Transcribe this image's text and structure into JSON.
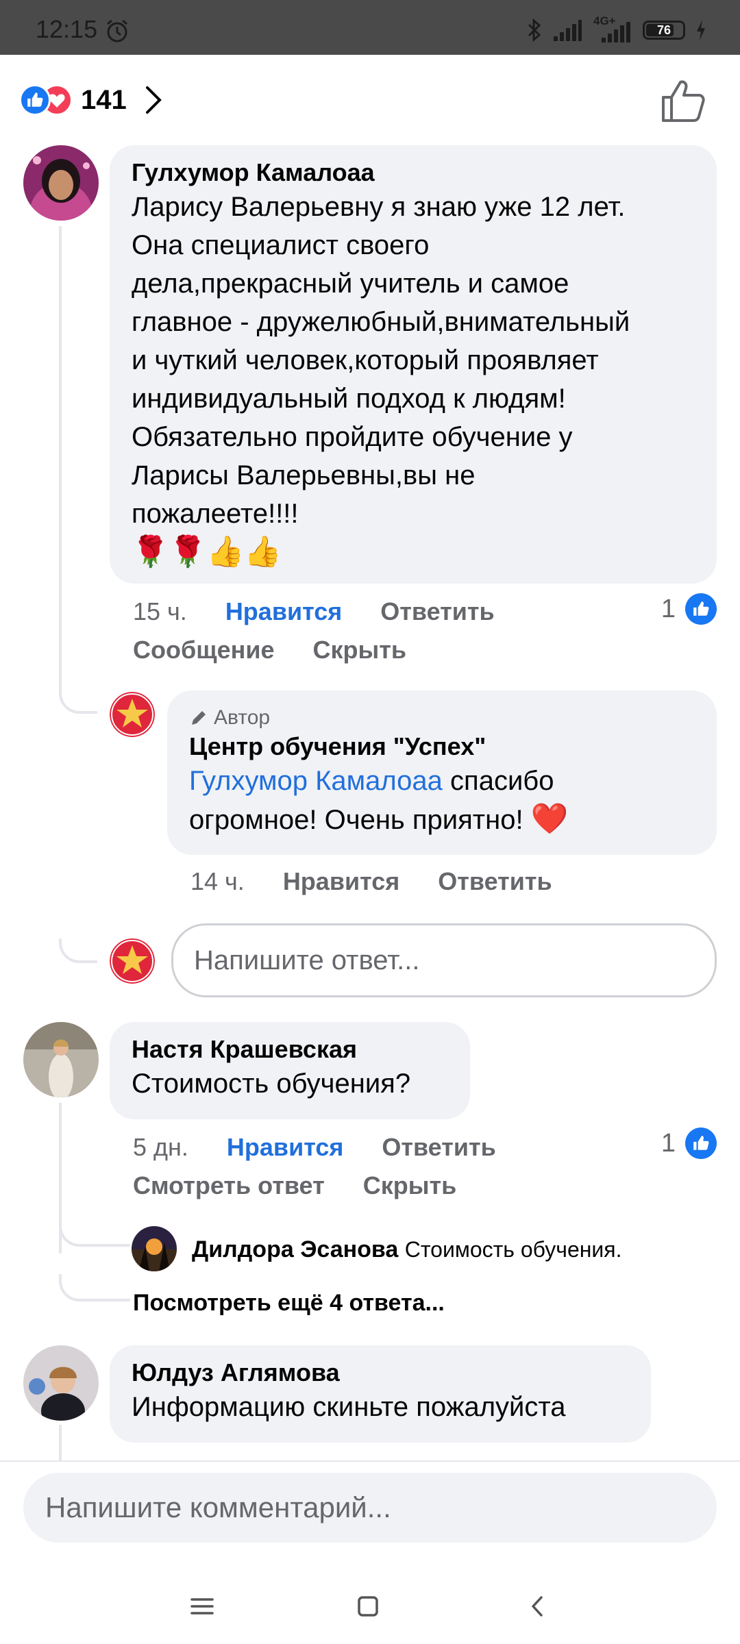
{
  "status_bar": {
    "time": "12:15",
    "network": "4G+",
    "battery": "76",
    "battery_level": 0.76,
    "icons": [
      "alarm-icon",
      "bluetooth-icon",
      "signal-icon",
      "signal-4g-icon",
      "battery-icon",
      "charging-icon"
    ]
  },
  "reactions": {
    "count": "141",
    "types": [
      "like",
      "love"
    ]
  },
  "comments": [
    {
      "author": "Гулхумор Камалоаа",
      "lines": [
        "Ларису Валерьевну я знаю уже 12 лет.",
        "Она специалист своего",
        "дела,прекрасный учитель и самое",
        "главное - дружелюбный,внимательный",
        "и чуткий человек,который проявляет",
        "индивидуальный подход к людям!",
        "Обязательно пройдите обучение у",
        "Ларисы Валерьевны,вы не",
        "пожалеете!!!!"
      ],
      "emoji": "🌹🌹👍👍",
      "time": "15 ч.",
      "like_label": "Нравится",
      "reply_label": "Ответить",
      "message_label": "Сообщение",
      "hide_label": "Скрыть",
      "reaction_count": "1",
      "reply": {
        "badge": "Автор",
        "author": "Центр обучения \"Успех\"",
        "mention": "Гулхумор Камалоаа",
        "text_after_mention": " спасибо",
        "line2": "огромное! Очень приятно!",
        "emoji": "❤️",
        "time": "14 ч.",
        "like_label": "Нравится",
        "reply_label": "Ответить"
      },
      "reply_placeholder": "Напишите ответ..."
    },
    {
      "author": "Настя Крашевская",
      "text": "Стоимость обучения?",
      "time": "5 дн.",
      "like_label": "Нравится",
      "reply_label": "Ответить",
      "view_reply_label": "Смотреть ответ",
      "hide_label": "Скрыть",
      "reaction_count": "1",
      "preview_reply": {
        "author": "Дилдора Эсанова",
        "text": "Стоимость обучения."
      },
      "more_replies": "Посмотреть ещё 4 ответа..."
    },
    {
      "author": "Юлдуз Аглямова",
      "text": "Информацию скиньте пожалуйста"
    }
  ],
  "comment_input": {
    "placeholder": "Напишите комментарий..."
  },
  "colors": {
    "accent_blue": "#216fdb",
    "like_blue": "#1877f2",
    "love_red": "#f33e58",
    "bubble": "#f0f2f5",
    "secondary_text": "#65676b"
  }
}
